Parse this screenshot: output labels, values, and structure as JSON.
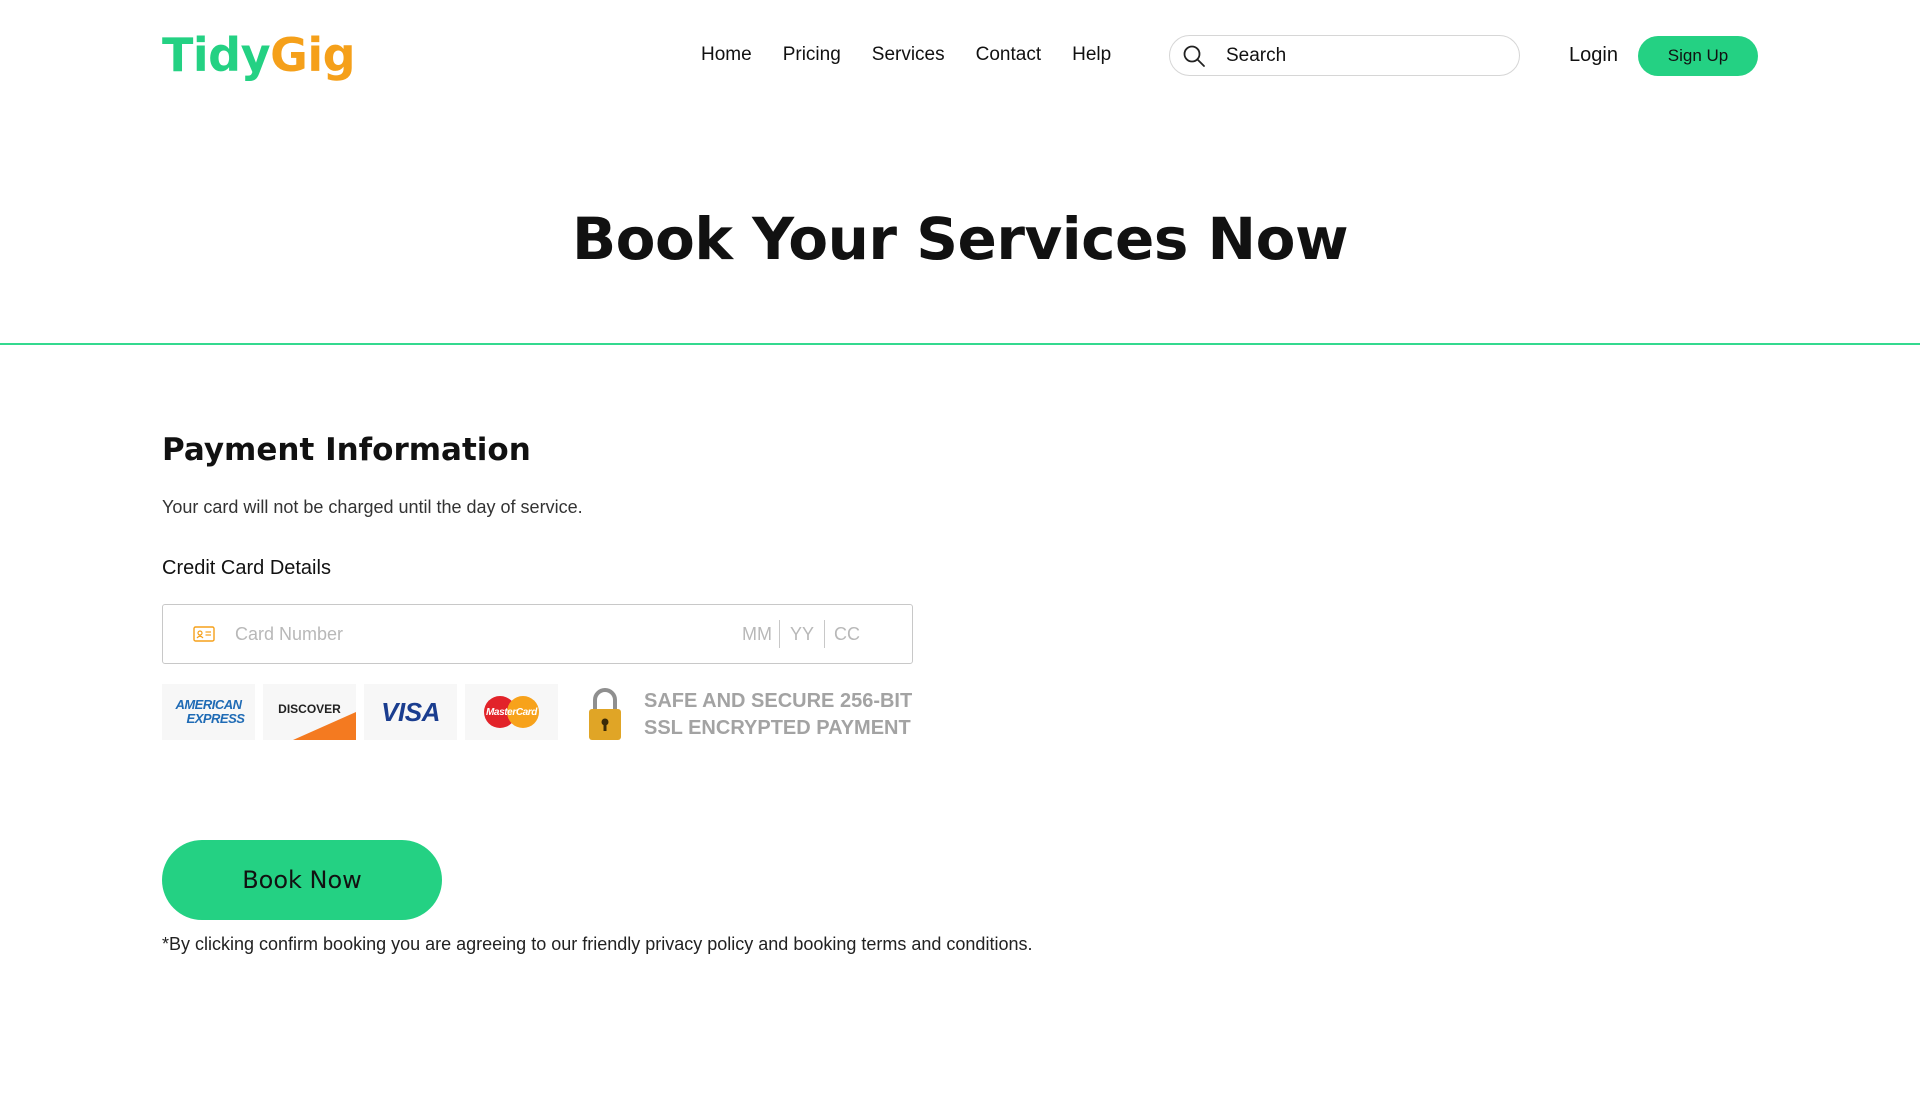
{
  "brand": {
    "part1": "Tidy",
    "part2": "Gig",
    "color1": "#24d183",
    "color2": "#f5a01a"
  },
  "nav": {
    "items": [
      {
        "label": "Home"
      },
      {
        "label": "Pricing"
      },
      {
        "label": "Services"
      },
      {
        "label": "Contact"
      },
      {
        "label": "Help"
      }
    ]
  },
  "search": {
    "placeholder": "Search",
    "icon": "search-icon"
  },
  "auth": {
    "login_label": "Login",
    "signup_label": "Sign Up"
  },
  "hero": {
    "title": "Book Your Services Now"
  },
  "payment": {
    "title": "Payment Information",
    "subtitle": "Your card will not be charged until the day of service.",
    "cc_label": "Credit Card Details",
    "card_number_placeholder": "Card Number",
    "month_placeholder": "MM",
    "year_placeholder": "YY",
    "cvc_placeholder": "CC",
    "card_logos": {
      "amex_line1": "AMERICAN",
      "amex_line2": "EXPRESS",
      "discover": "DISCOVER",
      "visa": "VISA",
      "mastercard": "MasterCard"
    },
    "secure_line1": "SAFE AND SECURE 256-BIT",
    "secure_line2": "SSL ENCRYPTED PAYMENT"
  },
  "actions": {
    "book_label": "Book Now",
    "terms": "*By clicking confirm booking you are agreeing to our friendly privacy policy and booking terms and conditions."
  },
  "colors": {
    "accent": "#24d183",
    "divider": "#34d98f"
  }
}
